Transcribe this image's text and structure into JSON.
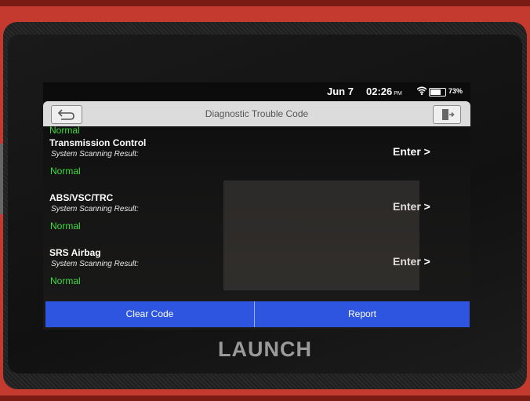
{
  "status_bar": {
    "date": "Jun 7",
    "time": "02:26",
    "ampm": "PM",
    "battery_percent": "73%",
    "battery_level": 0.73,
    "wifi_icon": "wifi-icon"
  },
  "header": {
    "title": "Diagnostic Trouble Code",
    "back_icon": "back-arrow-icon",
    "exit_icon": "exit-icon"
  },
  "list": {
    "partial_status": "Normal",
    "items": [
      {
        "name": "Transmission Control",
        "result_label": "System Scanning Result:",
        "status": "Normal",
        "action": "Enter >"
      },
      {
        "name": "ABS/VSC/TRC",
        "result_label": "System Scanning Result:",
        "status": "Normal",
        "action": "Enter >"
      },
      {
        "name": "SRS Airbag",
        "result_label": "System Scanning Result:",
        "status": "Normal",
        "action": "Enter >"
      }
    ]
  },
  "footer": {
    "clear_code": "Clear Code",
    "report": "Report"
  },
  "device": {
    "brand": "LAUNCH"
  },
  "colors": {
    "accent": "#2d55e0",
    "status_normal": "#3ddc3d",
    "device_shell": "#c53a2e"
  }
}
